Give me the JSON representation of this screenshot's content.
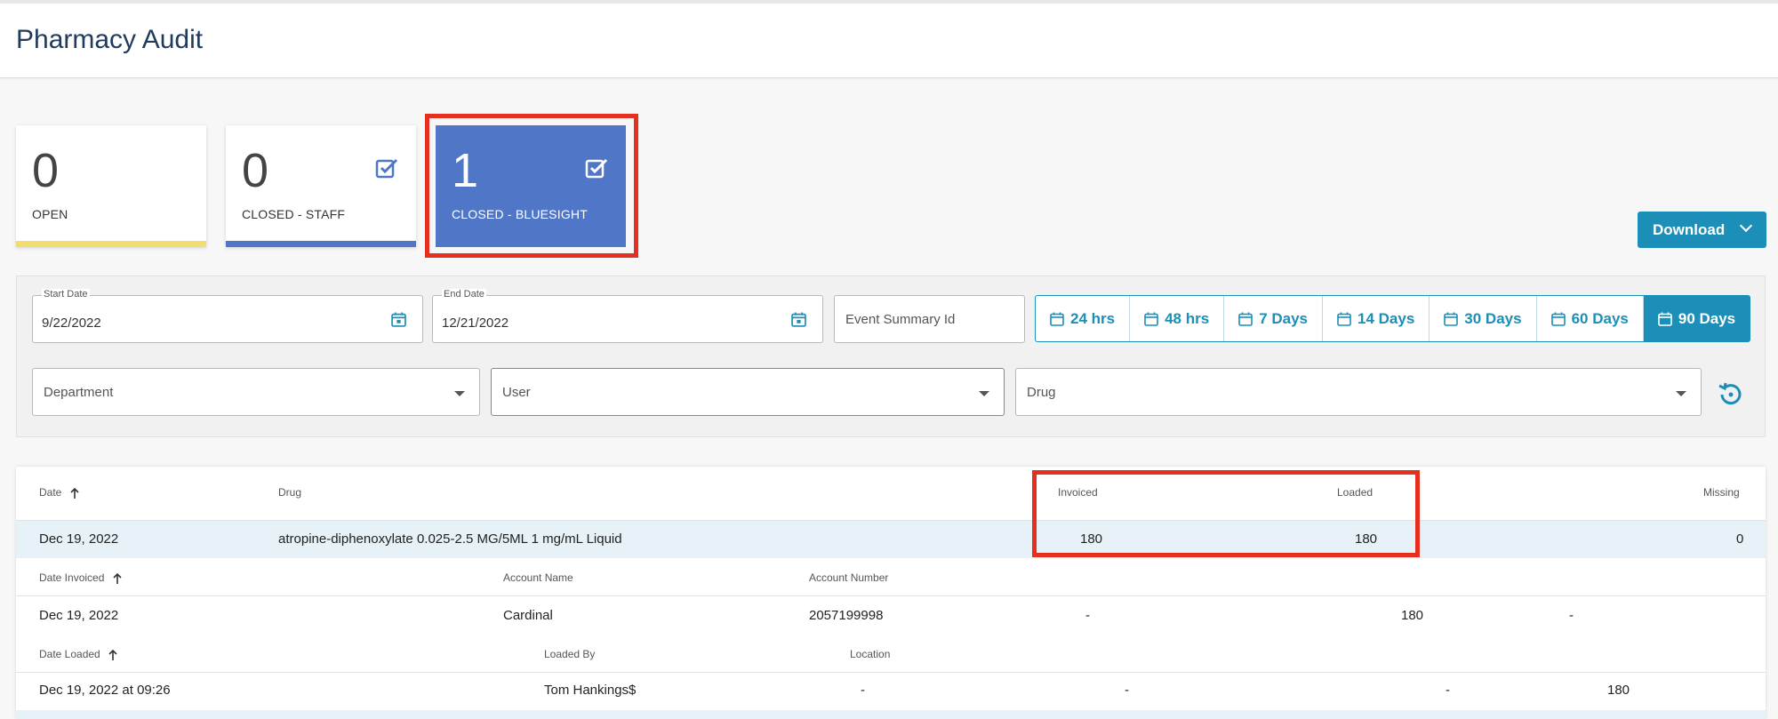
{
  "header": {
    "title": "Pharmacy Audit"
  },
  "cards": [
    {
      "count": "0",
      "label": "OPEN",
      "bar_color": "#f3dd6c"
    },
    {
      "count": "0",
      "label": "CLOSED - STAFF",
      "bar_color": "#5077c7"
    },
    {
      "count": "1",
      "label": "CLOSED - BLUESIGHT",
      "active": true
    }
  ],
  "toolbar": {
    "download_label": "Download"
  },
  "filters": {
    "start_date_label": "Start Date",
    "start_date": "9/22/2022",
    "end_date_label": "End Date",
    "end_date": "12/21/2022",
    "event_summary_placeholder": "Event Summary Id",
    "ranges": [
      "24 hrs",
      "48 hrs",
      "7 Days",
      "14 Days",
      "30 Days",
      "60 Days",
      "90 Days"
    ],
    "active_range": "90 Days",
    "department_placeholder": "Department",
    "user_placeholder": "User",
    "drug_placeholder": "Drug"
  },
  "table": {
    "headers": {
      "date": "Date",
      "drug": "Drug",
      "invoiced": "Invoiced",
      "loaded": "Loaded",
      "missing": "Missing"
    },
    "row": {
      "date": "Dec 19, 2022",
      "drug": "atropine-diphenoxylate 0.025-2.5 MG/5ML 1 mg/mL Liquid",
      "invoiced": "180",
      "loaded": "180",
      "missing": "0"
    },
    "invoice_headers": {
      "date_invoiced": "Date Invoiced",
      "account_name": "Account Name",
      "account_number": "Account Number"
    },
    "invoice_row": {
      "date": "Dec 19, 2022",
      "account_name": "Cardinal",
      "account_number": "2057199998",
      "col4": "-",
      "col5": "180",
      "col6": "-"
    },
    "loaded_headers": {
      "date_loaded": "Date Loaded",
      "loaded_by": "Loaded By",
      "location": "Location"
    },
    "loaded_row": {
      "date": "Dec 19, 2022 at 09:26",
      "loaded_by": "Tom Hankings$",
      "location": "-",
      "col4": "-",
      "col5": "-",
      "col6": "180"
    }
  },
  "colors": {
    "accent": "#1b8fb8",
    "card_active": "#5077c7",
    "highlight": "#e5301f",
    "row_highlight": "#e6f2f7"
  }
}
